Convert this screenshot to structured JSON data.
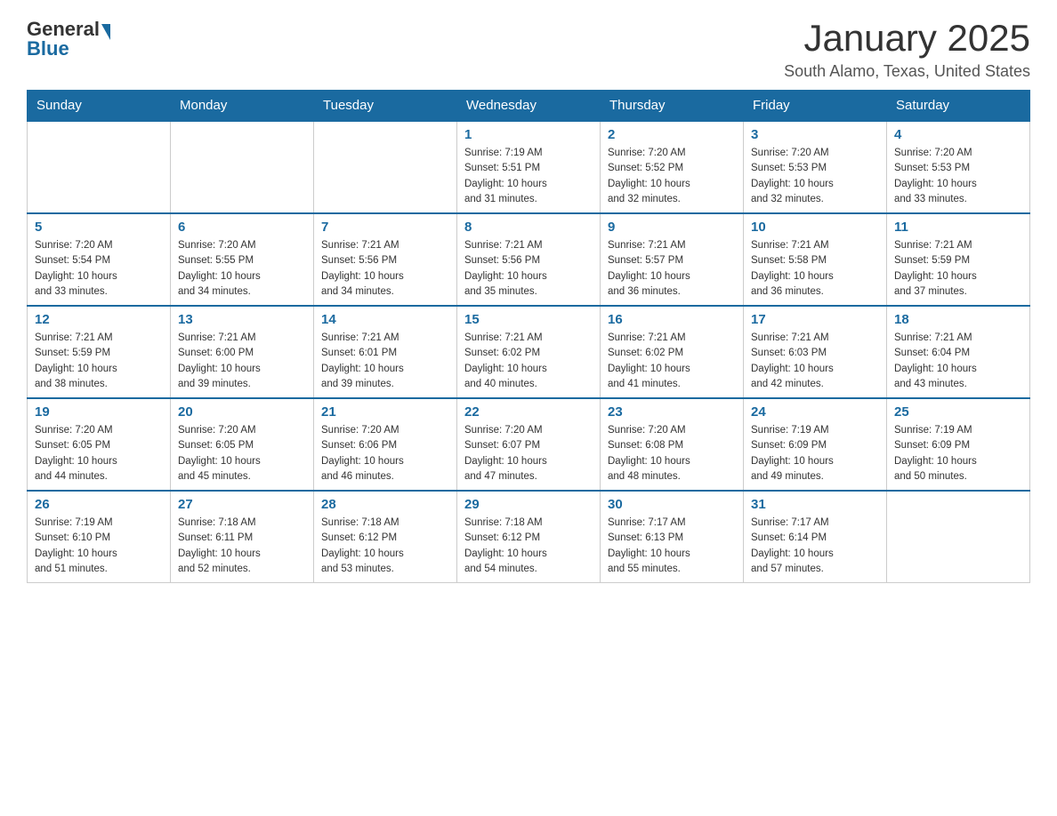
{
  "header": {
    "logo_general": "General",
    "logo_blue": "Blue",
    "title": "January 2025",
    "subtitle": "South Alamo, Texas, United States"
  },
  "days_of_week": [
    "Sunday",
    "Monday",
    "Tuesday",
    "Wednesday",
    "Thursday",
    "Friday",
    "Saturday"
  ],
  "weeks": [
    [
      {
        "day": "",
        "info": ""
      },
      {
        "day": "",
        "info": ""
      },
      {
        "day": "",
        "info": ""
      },
      {
        "day": "1",
        "info": "Sunrise: 7:19 AM\nSunset: 5:51 PM\nDaylight: 10 hours\nand 31 minutes."
      },
      {
        "day": "2",
        "info": "Sunrise: 7:20 AM\nSunset: 5:52 PM\nDaylight: 10 hours\nand 32 minutes."
      },
      {
        "day": "3",
        "info": "Sunrise: 7:20 AM\nSunset: 5:53 PM\nDaylight: 10 hours\nand 32 minutes."
      },
      {
        "day": "4",
        "info": "Sunrise: 7:20 AM\nSunset: 5:53 PM\nDaylight: 10 hours\nand 33 minutes."
      }
    ],
    [
      {
        "day": "5",
        "info": "Sunrise: 7:20 AM\nSunset: 5:54 PM\nDaylight: 10 hours\nand 33 minutes."
      },
      {
        "day": "6",
        "info": "Sunrise: 7:20 AM\nSunset: 5:55 PM\nDaylight: 10 hours\nand 34 minutes."
      },
      {
        "day": "7",
        "info": "Sunrise: 7:21 AM\nSunset: 5:56 PM\nDaylight: 10 hours\nand 34 minutes."
      },
      {
        "day": "8",
        "info": "Sunrise: 7:21 AM\nSunset: 5:56 PM\nDaylight: 10 hours\nand 35 minutes."
      },
      {
        "day": "9",
        "info": "Sunrise: 7:21 AM\nSunset: 5:57 PM\nDaylight: 10 hours\nand 36 minutes."
      },
      {
        "day": "10",
        "info": "Sunrise: 7:21 AM\nSunset: 5:58 PM\nDaylight: 10 hours\nand 36 minutes."
      },
      {
        "day": "11",
        "info": "Sunrise: 7:21 AM\nSunset: 5:59 PM\nDaylight: 10 hours\nand 37 minutes."
      }
    ],
    [
      {
        "day": "12",
        "info": "Sunrise: 7:21 AM\nSunset: 5:59 PM\nDaylight: 10 hours\nand 38 minutes."
      },
      {
        "day": "13",
        "info": "Sunrise: 7:21 AM\nSunset: 6:00 PM\nDaylight: 10 hours\nand 39 minutes."
      },
      {
        "day": "14",
        "info": "Sunrise: 7:21 AM\nSunset: 6:01 PM\nDaylight: 10 hours\nand 39 minutes."
      },
      {
        "day": "15",
        "info": "Sunrise: 7:21 AM\nSunset: 6:02 PM\nDaylight: 10 hours\nand 40 minutes."
      },
      {
        "day": "16",
        "info": "Sunrise: 7:21 AM\nSunset: 6:02 PM\nDaylight: 10 hours\nand 41 minutes."
      },
      {
        "day": "17",
        "info": "Sunrise: 7:21 AM\nSunset: 6:03 PM\nDaylight: 10 hours\nand 42 minutes."
      },
      {
        "day": "18",
        "info": "Sunrise: 7:21 AM\nSunset: 6:04 PM\nDaylight: 10 hours\nand 43 minutes."
      }
    ],
    [
      {
        "day": "19",
        "info": "Sunrise: 7:20 AM\nSunset: 6:05 PM\nDaylight: 10 hours\nand 44 minutes."
      },
      {
        "day": "20",
        "info": "Sunrise: 7:20 AM\nSunset: 6:05 PM\nDaylight: 10 hours\nand 45 minutes."
      },
      {
        "day": "21",
        "info": "Sunrise: 7:20 AM\nSunset: 6:06 PM\nDaylight: 10 hours\nand 46 minutes."
      },
      {
        "day": "22",
        "info": "Sunrise: 7:20 AM\nSunset: 6:07 PM\nDaylight: 10 hours\nand 47 minutes."
      },
      {
        "day": "23",
        "info": "Sunrise: 7:20 AM\nSunset: 6:08 PM\nDaylight: 10 hours\nand 48 minutes."
      },
      {
        "day": "24",
        "info": "Sunrise: 7:19 AM\nSunset: 6:09 PM\nDaylight: 10 hours\nand 49 minutes."
      },
      {
        "day": "25",
        "info": "Sunrise: 7:19 AM\nSunset: 6:09 PM\nDaylight: 10 hours\nand 50 minutes."
      }
    ],
    [
      {
        "day": "26",
        "info": "Sunrise: 7:19 AM\nSunset: 6:10 PM\nDaylight: 10 hours\nand 51 minutes."
      },
      {
        "day": "27",
        "info": "Sunrise: 7:18 AM\nSunset: 6:11 PM\nDaylight: 10 hours\nand 52 minutes."
      },
      {
        "day": "28",
        "info": "Sunrise: 7:18 AM\nSunset: 6:12 PM\nDaylight: 10 hours\nand 53 minutes."
      },
      {
        "day": "29",
        "info": "Sunrise: 7:18 AM\nSunset: 6:12 PM\nDaylight: 10 hours\nand 54 minutes."
      },
      {
        "day": "30",
        "info": "Sunrise: 7:17 AM\nSunset: 6:13 PM\nDaylight: 10 hours\nand 55 minutes."
      },
      {
        "day": "31",
        "info": "Sunrise: 7:17 AM\nSunset: 6:14 PM\nDaylight: 10 hours\nand 57 minutes."
      },
      {
        "day": "",
        "info": ""
      }
    ]
  ]
}
